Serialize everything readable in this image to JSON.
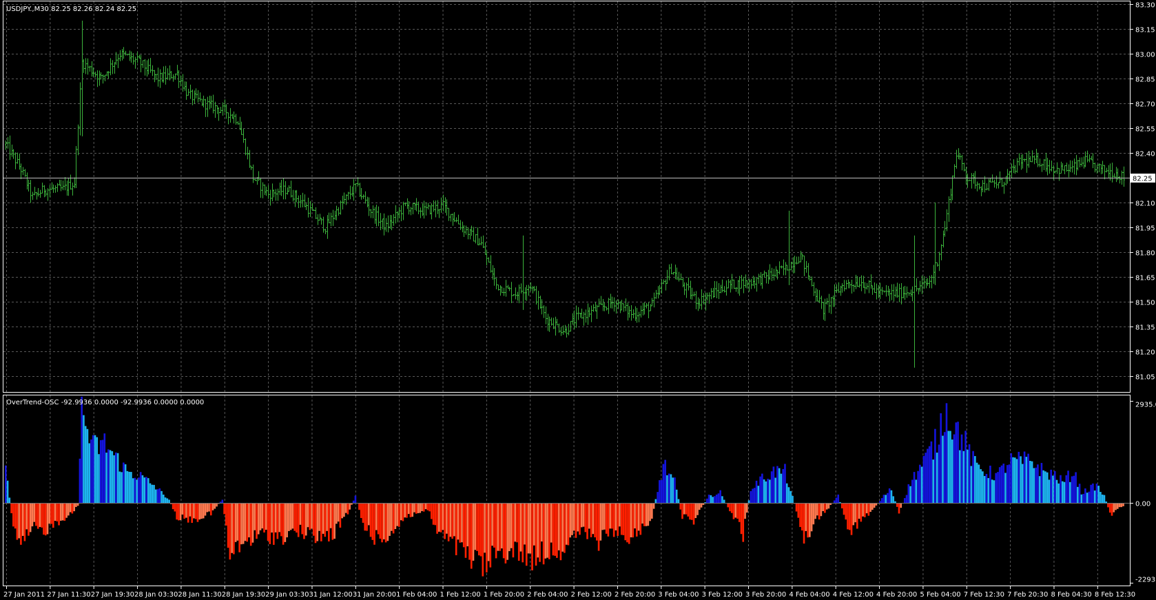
{
  "chart_data": [
    {
      "type": "ohlc",
      "header": "USDJPY.,M30  82.25 82.26 82.24 82.25",
      "symbol": "USDJPY.",
      "timeframe": "M30",
      "last_ohlc": [
        82.25,
        82.26,
        82.24,
        82.25
      ],
      "current_price_label": "82.25",
      "ylim": [
        80.97,
        83.3
      ],
      "y_tick_labels": [
        "83.30",
        "83.15",
        "83.00",
        "82.85",
        "82.70",
        "82.55",
        "82.40",
        "82.25",
        "82.10",
        "81.95",
        "81.80",
        "81.65",
        "81.50",
        "81.35",
        "81.20",
        "81.05"
      ],
      "bar_color": "#3cb43c",
      "grid": true,
      "anchor_closes": [
        [
          0,
          82.45
        ],
        [
          8,
          82.3
        ],
        [
          14,
          82.13
        ],
        [
          20,
          82.18
        ],
        [
          30,
          82.18
        ],
        [
          36,
          82.22
        ],
        [
          40,
          82.95
        ],
        [
          50,
          82.85
        ],
        [
          60,
          83.0
        ],
        [
          70,
          82.95
        ],
        [
          80,
          82.85
        ],
        [
          90,
          82.88
        ],
        [
          96,
          82.75
        ],
        [
          104,
          82.7
        ],
        [
          116,
          82.65
        ],
        [
          122,
          82.6
        ],
        [
          130,
          82.25
        ],
        [
          138,
          82.15
        ],
        [
          148,
          82.18
        ],
        [
          156,
          82.1
        ],
        [
          168,
          81.95
        ],
        [
          176,
          82.08
        ],
        [
          184,
          82.2
        ],
        [
          192,
          82.05
        ],
        [
          200,
          81.95
        ],
        [
          210,
          82.08
        ],
        [
          220,
          82.05
        ],
        [
          230,
          82.08
        ],
        [
          240,
          81.95
        ],
        [
          250,
          81.85
        ],
        [
          258,
          81.6
        ],
        [
          268,
          81.55
        ],
        [
          276,
          81.6
        ],
        [
          284,
          81.4
        ],
        [
          294,
          81.32
        ],
        [
          300,
          81.4
        ],
        [
          310,
          81.45
        ],
        [
          320,
          81.5
        ],
        [
          330,
          81.42
        ],
        [
          340,
          81.48
        ],
        [
          350,
          81.7
        ],
        [
          356,
          81.6
        ],
        [
          364,
          81.5
        ],
        [
          372,
          81.55
        ],
        [
          380,
          81.6
        ],
        [
          392,
          81.62
        ],
        [
          400,
          81.65
        ],
        [
          410,
          81.7
        ],
        [
          418,
          81.78
        ],
        [
          424,
          81.6
        ],
        [
          430,
          81.45
        ],
        [
          440,
          81.6
        ],
        [
          450,
          81.62
        ],
        [
          460,
          81.55
        ],
        [
          470,
          81.55
        ],
        [
          480,
          81.58
        ],
        [
          486,
          81.62
        ],
        [
          490,
          81.75
        ],
        [
          494,
          81.95
        ],
        [
          500,
          82.4
        ],
        [
          506,
          82.25
        ],
        [
          514,
          82.2
        ],
        [
          524,
          82.22
        ],
        [
          534,
          82.35
        ],
        [
          544,
          82.35
        ],
        [
          552,
          82.3
        ],
        [
          560,
          82.3
        ],
        [
          568,
          82.35
        ],
        [
          576,
          82.3
        ],
        [
          584,
          82.28
        ],
        [
          588,
          82.25
        ]
      ],
      "spike_bars": [
        [
          40,
          83.2,
          82.5
        ],
        [
          272,
          81.9,
          81.45
        ],
        [
          412,
          82.05,
          81.6
        ],
        [
          478,
          81.9,
          81.1
        ],
        [
          489,
          82.1,
          81.6
        ]
      ]
    },
    {
      "type": "bar",
      "header": "OverTrend-OSC -92.9936 0.0000 -92.9936 0.0000 0.0000",
      "indicator": "OverTrend-OSC",
      "last_values": [
        -92.9936,
        0.0,
        -92.9936,
        0.0,
        0.0
      ],
      "ylim": [
        -2293.19,
        2935.08
      ],
      "y_tick_labels": [
        "2935.08",
        "0.00",
        "-2293.19"
      ],
      "colors": {
        "positive_strong": "#1414dc",
        "positive_light": "#1eb4f0",
        "negative_strong": "#ff2000",
        "negative_light": "#ff7a50"
      },
      "segments": [
        [
          0,
          1100
        ],
        [
          4,
          -800
        ],
        [
          8,
          -1300
        ],
        [
          14,
          -700
        ],
        [
          20,
          -800
        ],
        [
          26,
          -600
        ],
        [
          34,
          -300
        ],
        [
          38,
          -100
        ],
        [
          40,
          2600
        ],
        [
          46,
          1600
        ],
        [
          52,
          1700
        ],
        [
          58,
          1300
        ],
        [
          64,
          900
        ],
        [
          70,
          800
        ],
        [
          78,
          500
        ],
        [
          86,
          100
        ],
        [
          90,
          -400
        ],
        [
          98,
          -500
        ],
        [
          108,
          -300
        ],
        [
          114,
          100
        ],
        [
          118,
          -1600
        ],
        [
          124,
          -1200
        ],
        [
          134,
          -900
        ],
        [
          144,
          -1000
        ],
        [
          154,
          -800
        ],
        [
          164,
          -1000
        ],
        [
          172,
          -900
        ],
        [
          180,
          -300
        ],
        [
          184,
          200
        ],
        [
          188,
          -600
        ],
        [
          196,
          -1100
        ],
        [
          204,
          -800
        ],
        [
          210,
          -400
        ],
        [
          216,
          -300
        ],
        [
          222,
          -200
        ],
        [
          228,
          -900
        ],
        [
          236,
          -1200
        ],
        [
          244,
          -1600
        ],
        [
          252,
          -1800
        ],
        [
          260,
          -1400
        ],
        [
          270,
          -1400
        ],
        [
          276,
          -1600
        ],
        [
          284,
          -1400
        ],
        [
          294,
          -1300
        ],
        [
          302,
          -800
        ],
        [
          312,
          -1100
        ],
        [
          320,
          -800
        ],
        [
          326,
          -1000
        ],
        [
          332,
          -900
        ],
        [
          340,
          -400
        ],
        [
          346,
          1100
        ],
        [
          352,
          600
        ],
        [
          356,
          -400
        ],
        [
          362,
          -500
        ],
        [
          370,
          200
        ],
        [
          376,
          300
        ],
        [
          382,
          -300
        ],
        [
          388,
          -900
        ],
        [
          392,
          400
        ],
        [
          398,
          700
        ],
        [
          404,
          900
        ],
        [
          410,
          900
        ],
        [
          416,
          -200
        ],
        [
          420,
          -1100
        ],
        [
          426,
          -500
        ],
        [
          432,
          -200
        ],
        [
          438,
          200
        ],
        [
          444,
          -800
        ],
        [
          450,
          -500
        ],
        [
          456,
          -200
        ],
        [
          462,
          200
        ],
        [
          466,
          400
        ],
        [
          470,
          -300
        ],
        [
          476,
          600
        ],
        [
          482,
          1100
        ],
        [
          490,
          1800
        ],
        [
          494,
          2700
        ],
        [
          498,
          2300
        ],
        [
          504,
          1800
        ],
        [
          510,
          1100
        ],
        [
          516,
          900
        ],
        [
          522,
          800
        ],
        [
          528,
          1200
        ],
        [
          534,
          1200
        ],
        [
          540,
          1200
        ],
        [
          546,
          900
        ],
        [
          552,
          800
        ],
        [
          556,
          600
        ],
        [
          562,
          900
        ],
        [
          566,
          300
        ],
        [
          570,
          400
        ],
        [
          574,
          500
        ],
        [
          578,
          200
        ],
        [
          582,
          -400
        ],
        [
          586,
          -100
        ],
        [
          588,
          -93
        ]
      ]
    }
  ],
  "x_axis": {
    "labels": [
      "27 Jan 2011",
      "27 Jan 11:30",
      "27 Jan 19:30",
      "28 Jan 03:30",
      "28 Jan 11:30",
      "28 Jan 19:30",
      "29 Jan 03:30",
      "31 Jan 12:00",
      "31 Jan 20:00",
      "1 Feb 04:00",
      "1 Feb 12:00",
      "1 Feb 20:00",
      "2 Feb 04:00",
      "2 Feb 12:00",
      "2 Feb 20:00",
      "3 Feb 04:00",
      "3 Feb 12:00",
      "3 Feb 20:00",
      "4 Feb 04:00",
      "4 Feb 12:00",
      "4 Feb 20:00",
      "5 Feb 04:00",
      "7 Feb 12:30",
      "7 Feb 20:30",
      "8 Feb 04:30",
      "8 Feb 12:30"
    ]
  }
}
